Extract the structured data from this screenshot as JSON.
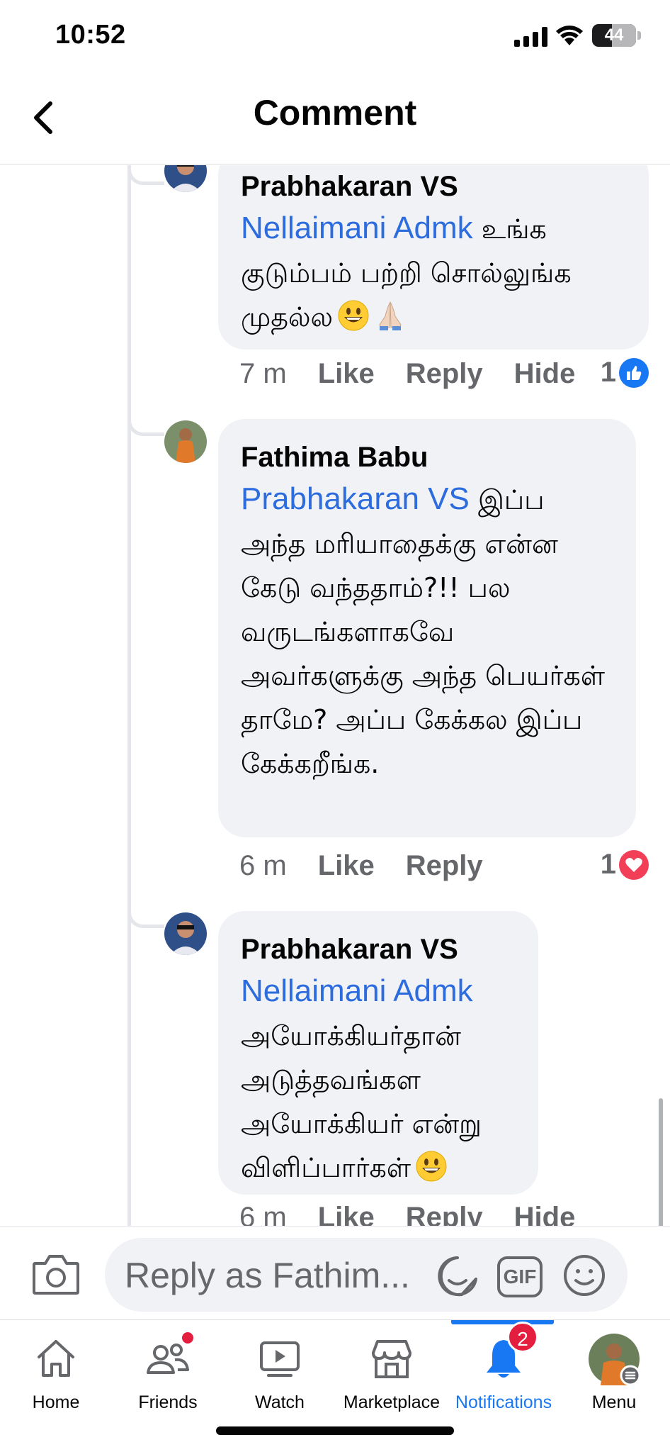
{
  "status_bar": {
    "time": "10:52",
    "battery": "44"
  },
  "header": {
    "title": "Comment"
  },
  "comments": [
    {
      "author": "Prabhakaran VS",
      "mention": "Nellaimani Admk",
      "text": " உங்க குடும்பம் பற்றி சொல்லுங்க முதல்ல",
      "emoji": [
        "grinning-face",
        "folded-hands"
      ],
      "time": "7 m",
      "like": "Like",
      "reply": "Reply",
      "hide": "Hide",
      "reaction_count": "1",
      "reaction": "like"
    },
    {
      "author": "Fathima Babu",
      "mention": "Prabhakaran VS",
      "text": " இப்ப அந்த மரியாதைக்கு என்ன கேடு வந்ததாம்?!! பல வருடங்களாகவே அவர்களுக்கு அந்த பெயர்கள் தாமே?  அப்ப கேக்கல இப்ப கேக்கறீங்க.",
      "time": "6 m",
      "like": "Like",
      "reply": "Reply",
      "reaction_count": "1",
      "reaction": "love"
    },
    {
      "author": "Prabhakaran VS",
      "mention": "Nellaimani Admk",
      "text": " அயோக்கியர்தான் அடுத்தவங்கள அயோக்கியர் என்று விளிப்பார்கள்",
      "emoji": [
        "grinning-face"
      ],
      "time": "6 m",
      "like": "Like",
      "reply": "Reply",
      "hide": "Hide"
    }
  ],
  "composer": {
    "placeholder": "Reply as Fathim...",
    "gif_label": "GIF"
  },
  "tabs": [
    {
      "label": "Home",
      "icon": "home-icon"
    },
    {
      "label": "Friends",
      "icon": "friends-icon"
    },
    {
      "label": "Watch",
      "icon": "watch-icon"
    },
    {
      "label": "Marketplace",
      "icon": "marketplace-icon"
    },
    {
      "label": "Notifications",
      "icon": "bell-icon",
      "badge": "2",
      "active": true
    },
    {
      "label": "Menu",
      "icon": "profile-avatar"
    }
  ],
  "colors": {
    "accent": "#1877f2",
    "mention": "#2d6cdf",
    "bubble": "#f0f2f5",
    "badge": "#e41e3f",
    "meta": "#65676b"
  }
}
